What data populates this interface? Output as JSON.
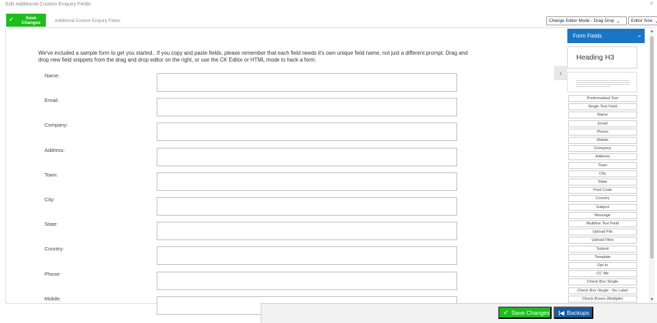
{
  "window": {
    "title": "Edit Additional Custom Enquiry Fields",
    "close_glyph": "×"
  },
  "toolbar": {
    "save_label": "Save Changes",
    "tab_label": "Additional Custom Enquiry Fields",
    "editor_mode": "Change Editor Mode - Drag Drop",
    "editor_size": "Editor Size"
  },
  "editor": {
    "intro_text": "We've included a sample form to get you started.. If you copy and paste fields, please remember that each field needs it's own unique field name, not just a different prompt. Drag and drop new field snippets from the drag and drop editor on the right, or use the CK Editor or HTML mode to hack a form.",
    "fields": [
      "Name:",
      "Email:",
      "Company:",
      "Address:",
      "Town:",
      "City:",
      "State:",
      "Country:",
      "Phone:",
      "Mobile:"
    ],
    "toggle_glyph": "›"
  },
  "panel": {
    "title": "Form Fields",
    "heading_preview": "Heading H3",
    "snippets": [
      "Preformatted Text",
      "Single Text Field",
      "Name",
      "Email",
      "Phone",
      "Mobile",
      "Company",
      "Address",
      "Town",
      "City",
      "State",
      "Post Code",
      "Country",
      "Subject",
      "Message",
      "Multiline Text Field",
      "Upload File",
      "Upload Files",
      "Submit",
      "Template",
      "Opt In",
      "CC Me",
      "Check Box Single",
      "Check Box Single - No Label",
      "Check Boxes (Multiple)"
    ]
  },
  "footer": {
    "save_label": "Save Changes",
    "backups_label": "Backups"
  },
  "colors": {
    "green": "#1dbd1d",
    "blue_panel": "#1a75c4",
    "blue_backups": "#1a5a9e"
  },
  "icons": [
    "check-icon",
    "close-icon",
    "chevron-down-icon",
    "chevron-right-icon",
    "skip-back-icon"
  ]
}
